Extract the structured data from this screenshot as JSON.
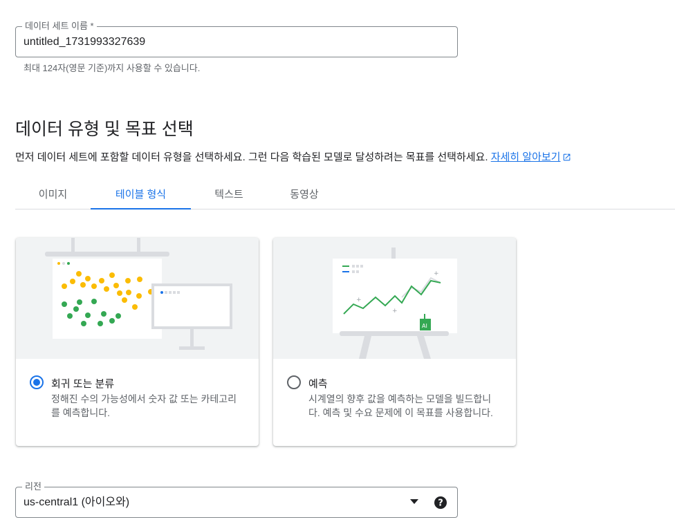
{
  "dataset_name": {
    "label": "데이터 세트 이름 *",
    "value": "untitled_1731993327639",
    "hint": "최대 124자(영문 기준)까지 사용할 수 있습니다."
  },
  "section": {
    "title": "데이터 유형 및 목표 선택",
    "description": "먼저 데이터 세트에 포함할 데이터 유형을 선택하세요. 그런 다음 학습된 모델로 달성하려는 목표를 선택하세요.",
    "learn_more": "자세히 알아보기",
    "learn_more_icon": "open-in-new-icon"
  },
  "tabs": [
    {
      "label": "이미지",
      "active": false
    },
    {
      "label": "테이블 형식",
      "active": true
    },
    {
      "label": "텍스트",
      "active": false
    },
    {
      "label": "동영상",
      "active": false
    }
  ],
  "cards": [
    {
      "title": "회귀 또는 분류",
      "description": "정해진 수의 가능성에서 숫자 값 또는 카테고리를 예측합니다.",
      "selected": true
    },
    {
      "title": "예측",
      "description": "시계열의 향후 값을 예측하는 모델을 빌드합니다. 예측 및 수요 문제에 이 목표를 사용합니다.",
      "selected": false,
      "badge": "AI"
    }
  ],
  "region": {
    "label": "리전",
    "value": "us-central1 (아이오와)"
  },
  "colors": {
    "accent": "#1a73e8",
    "yellow_dots": "#fbbc04",
    "green_dots": "#34a853"
  }
}
